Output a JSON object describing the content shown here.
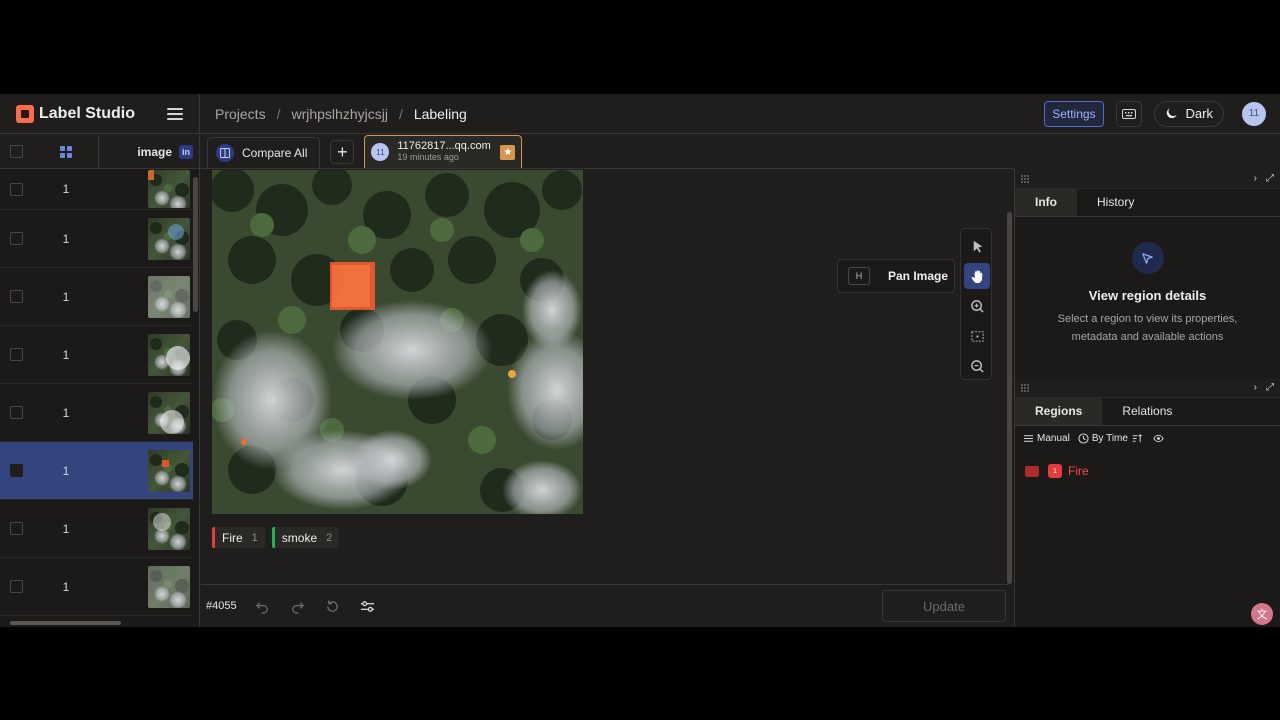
{
  "app": {
    "name": "Label Studio"
  },
  "breadcrumb": {
    "projects": "Projects",
    "separator": "/",
    "project": "wrjhpslhzhyjcsjj",
    "current": "Labeling"
  },
  "header": {
    "settings_label": "Settings",
    "theme_label": "Dark",
    "user_initials": "11"
  },
  "datatable": {
    "column_image": "image",
    "column_badge": "in",
    "rows": [
      {
        "id": "1",
        "selected": false
      },
      {
        "id": "1",
        "selected": false
      },
      {
        "id": "1",
        "selected": false
      },
      {
        "id": "1",
        "selected": false
      },
      {
        "id": "1",
        "selected": false
      },
      {
        "id": "1",
        "selected": true
      },
      {
        "id": "1",
        "selected": false
      },
      {
        "id": "1",
        "selected": false
      }
    ]
  },
  "tabs": {
    "compare_label": "Compare All",
    "plus_label": "+",
    "annotation": {
      "avatar": "11",
      "user": "11762817...qq.com",
      "time": "19 minutes ago",
      "star_icon": "star-icon"
    }
  },
  "labels": [
    {
      "name": "Fire",
      "hotkey": "1",
      "color": "#e53b3b"
    },
    {
      "name": "smoke",
      "hotkey": "2",
      "color": "#20b35a"
    }
  ],
  "tooltip": {
    "key": "H",
    "label": "Pan Image"
  },
  "toolbar": {
    "icons": [
      "pointer-icon",
      "hand-icon",
      "zoom-in-icon",
      "fit-icon",
      "zoom-out-icon"
    ],
    "active": "hand-icon"
  },
  "bottombar": {
    "task_id": "#4055",
    "update_label": "Update"
  },
  "info_panel": {
    "tabs": [
      "Info",
      "History"
    ],
    "title": "View region details",
    "description": "Select a region to view its properties, metadata and available actions"
  },
  "regions_panel": {
    "tabs": [
      "Relations",
      "Regions"
    ],
    "sort_manual": "Manual",
    "sort_time": "By Time",
    "regions": [
      {
        "index": "1",
        "label": "Fire",
        "color": "#e53b3b"
      }
    ]
  },
  "colors": {
    "accent": "#4e6bd6",
    "selected_row": "#33447f",
    "fire": "#e53b3b",
    "smoke": "#20b35a",
    "star": "#d6964b"
  }
}
